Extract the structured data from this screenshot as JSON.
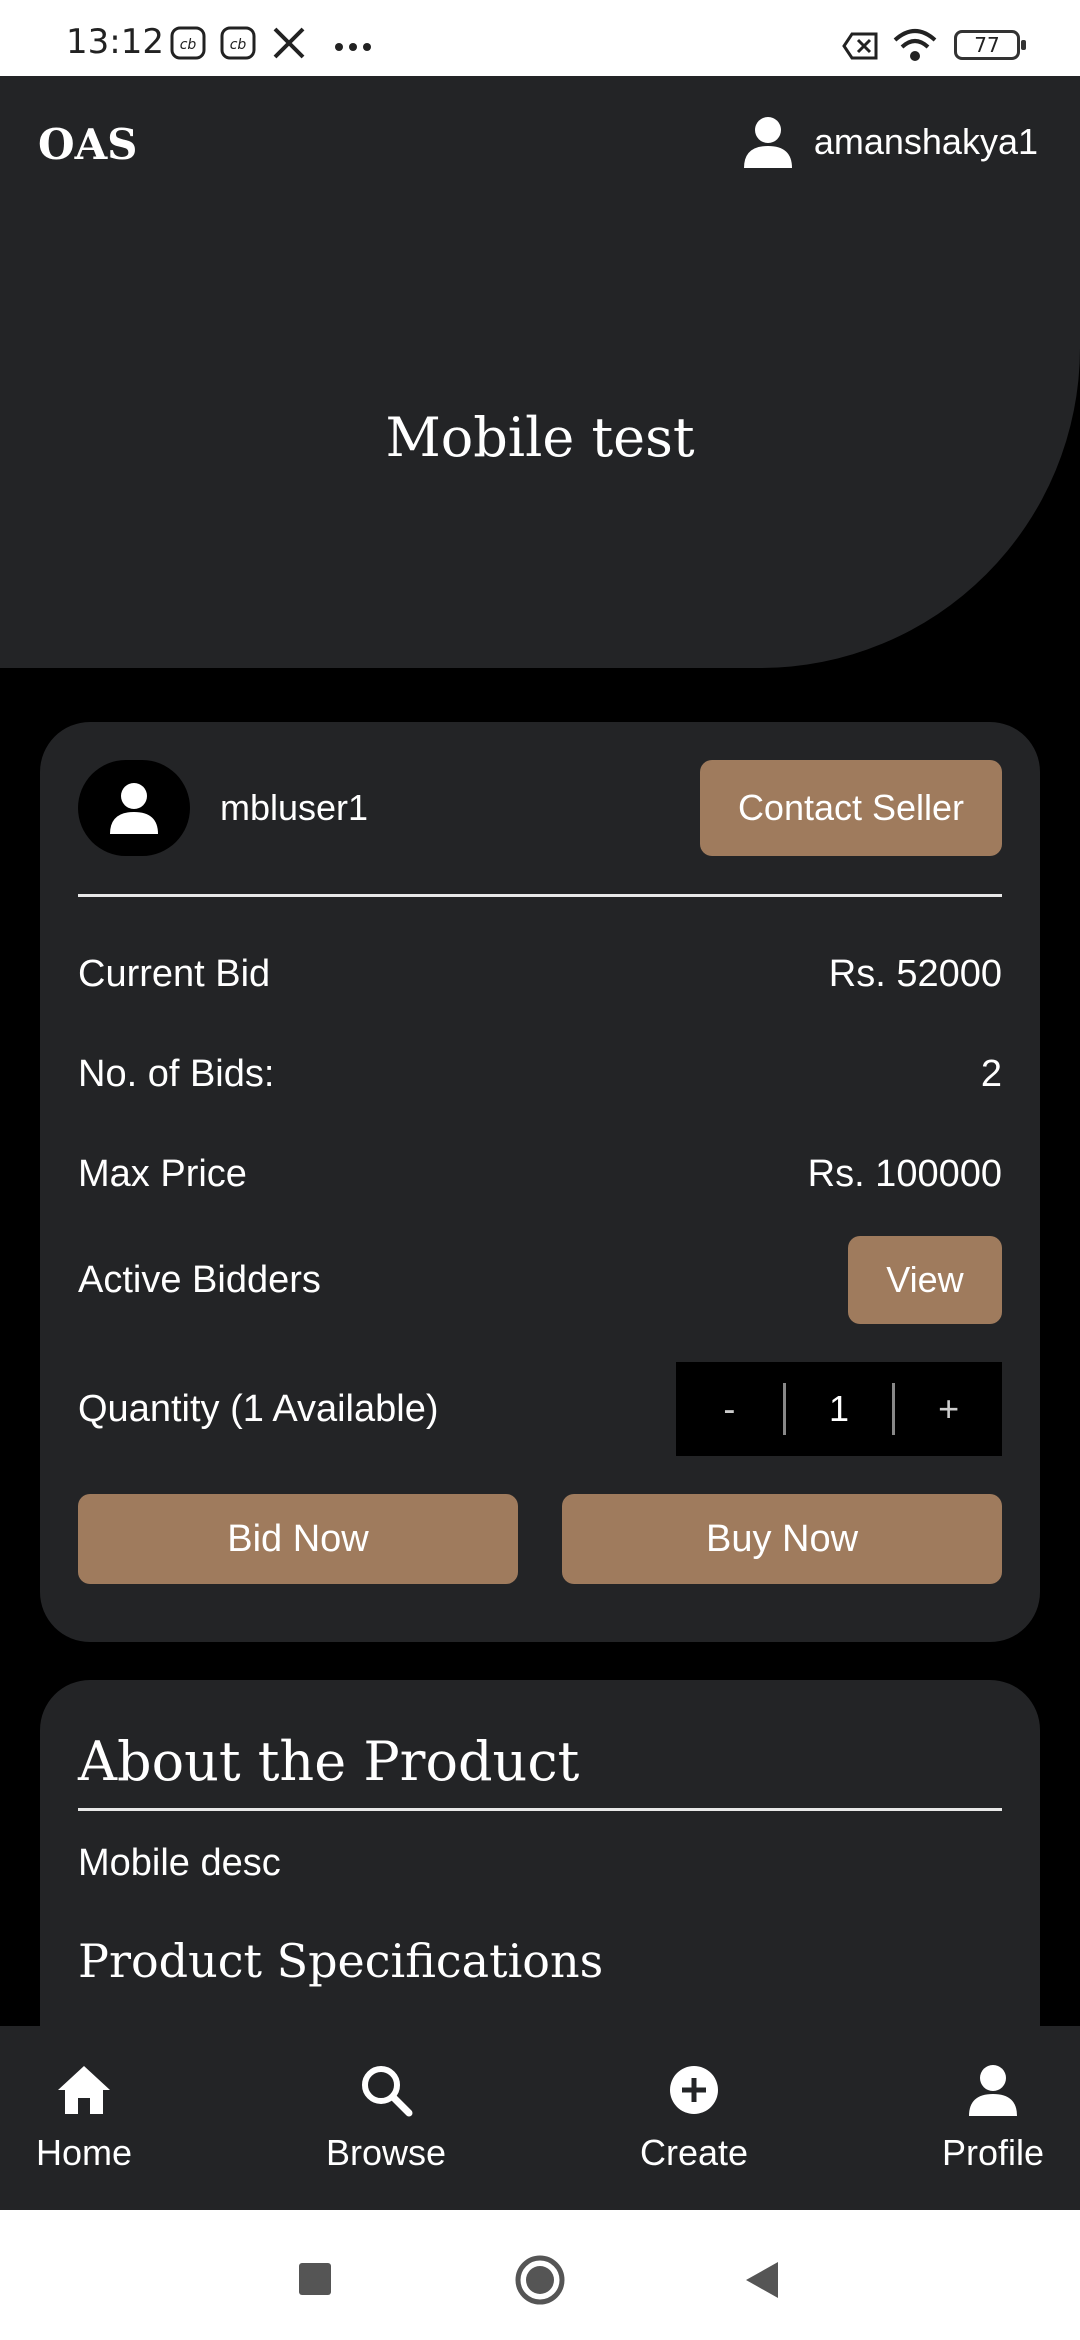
{
  "status_bar": {
    "time": "13:12",
    "battery": "77"
  },
  "header": {
    "brand": "OAS",
    "username": "amanshakya1",
    "page_title": "Mobile test"
  },
  "bid_card": {
    "seller_name": "mbluser1",
    "contact_label": "Contact Seller",
    "rows": {
      "current_bid": {
        "label": "Current Bid",
        "value": "Rs. 52000"
      },
      "num_bids": {
        "label": "No. of Bids:",
        "value": "2"
      },
      "max_price": {
        "label": "Max Price",
        "value": "Rs. 100000"
      },
      "active_bidders": {
        "label": "Active Bidders",
        "button": "View"
      },
      "quantity": {
        "label": "Quantity (1 Available)",
        "minus": "-",
        "value": "1",
        "plus": "+"
      }
    },
    "bid_now_label": "Bid Now",
    "buy_now_label": "Buy Now"
  },
  "about": {
    "title": "About the Product",
    "description": "Mobile desc",
    "specs_title": "Product Specifications"
  },
  "bottom_nav": {
    "items": [
      {
        "label": "Home",
        "icon": "home-icon"
      },
      {
        "label": "Browse",
        "icon": "search-icon"
      },
      {
        "label": "Create",
        "icon": "plus-circle-icon"
      },
      {
        "label": "Profile",
        "icon": "person-icon"
      }
    ]
  },
  "colors": {
    "accent": "#9f7b5d",
    "surface": "#232426",
    "background": "#000000"
  }
}
